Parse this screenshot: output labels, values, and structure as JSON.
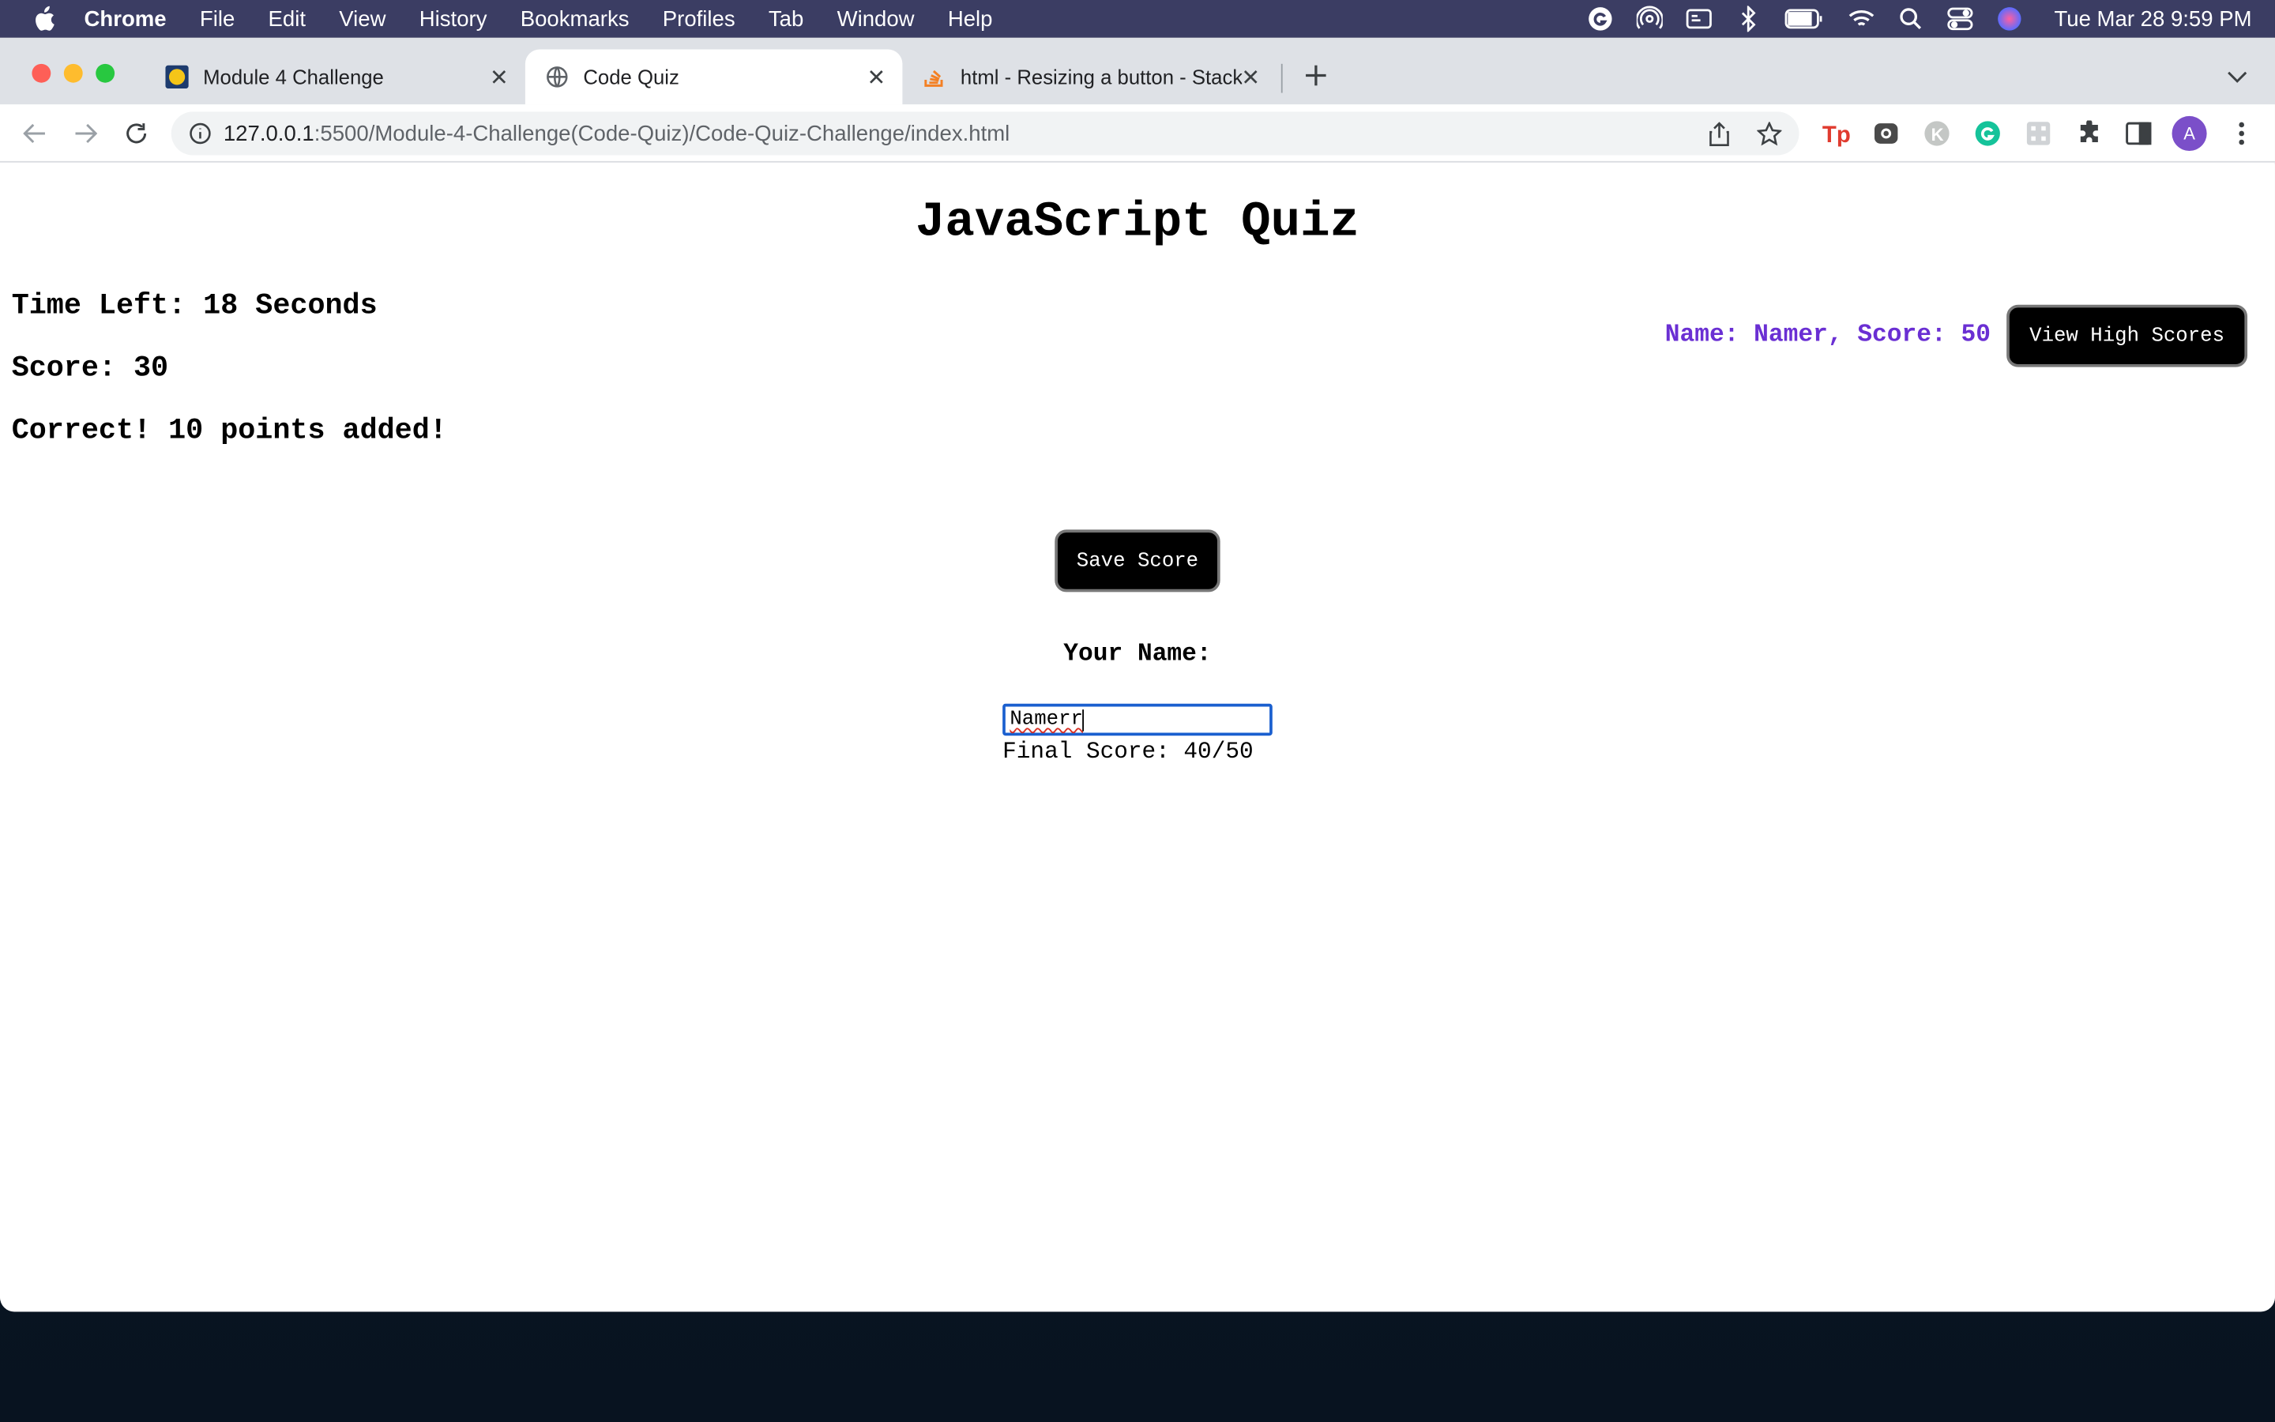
{
  "menubar": {
    "app": "Chrome",
    "items": [
      "File",
      "Edit",
      "View",
      "History",
      "Bookmarks",
      "Profiles",
      "Tab",
      "Window",
      "Help"
    ],
    "clock": "Tue Mar 28  9:59 PM"
  },
  "tabs": [
    {
      "title": "Module 4 Challenge",
      "favicon": "yellow-logo-icon"
    },
    {
      "title": "Code Quiz",
      "favicon": "globe-icon",
      "active": true
    },
    {
      "title": "html - Resizing a button - Stack",
      "favicon": "stack-overflow-icon"
    }
  ],
  "omnibox": {
    "host": "127.0.0.1",
    "path": ":5500/Module-4-Challenge(Code-Quiz)/Code-Quiz-Challenge/index.html"
  },
  "avatar_letter": "A",
  "page": {
    "title": "JavaScript Quiz",
    "time_left": "Time Left: 18 Seconds",
    "score": "Score: 30",
    "feedback": "Correct! 10 points added!",
    "high_score_entry": "Name: Namer, Score: 50",
    "view_high_scores": "View High Scores",
    "save_score": "Save Score",
    "name_label": "Your Name:",
    "name_value": "Namerr",
    "final_score": "Final Score: 40/50"
  },
  "colors": {
    "menubar_bg": "#3b3d63",
    "tabstrip_bg": "#dee1e6",
    "high_score_text": "#6a2fd3",
    "button_bg": "#000000",
    "input_focus": "#1a5fcf"
  }
}
